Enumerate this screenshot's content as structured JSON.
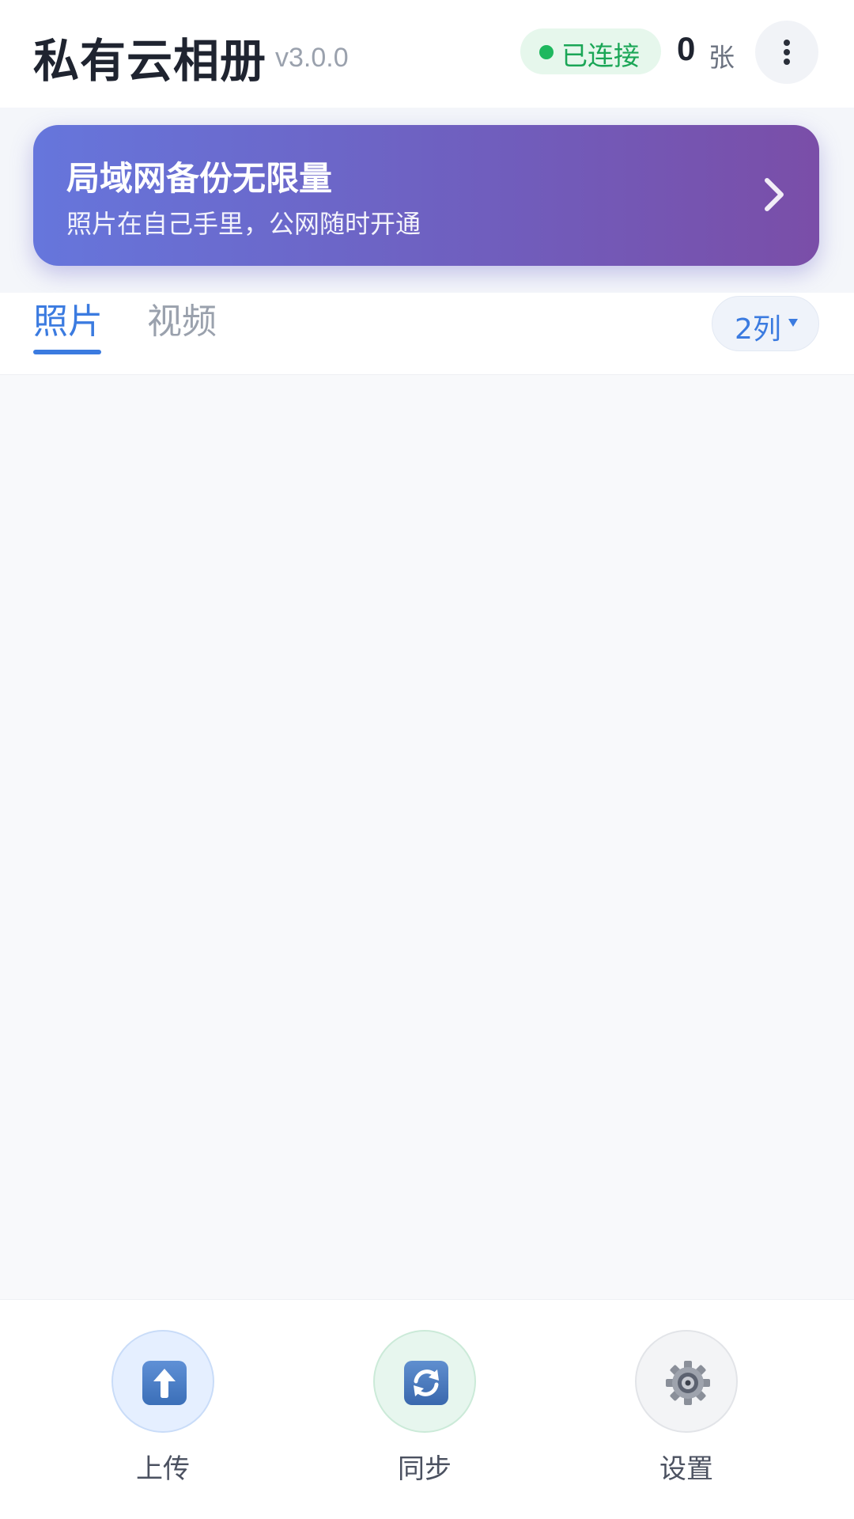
{
  "header": {
    "title": "私有云相册",
    "version": "v3.0.0",
    "status": "已连接",
    "photo_count": "0",
    "photo_count_unit": "张"
  },
  "banner": {
    "title": "局域网备份无限量",
    "subtitle": "照片在自己手里，公网随时开通"
  },
  "tabs": [
    {
      "label": "照片",
      "active": true
    },
    {
      "label": "视频",
      "active": false
    }
  ],
  "columns_selector": {
    "label": "2列"
  },
  "bottom_nav": [
    {
      "label": "上传",
      "icon": "upload-icon"
    },
    {
      "label": "同步",
      "icon": "sync-icon"
    },
    {
      "label": "设置",
      "icon": "settings-gear-icon"
    }
  ],
  "colors": {
    "accent": "#3b7be0",
    "status_green": "#1eb85e",
    "banner_start": "#6676dc",
    "banner_end": "#7a4ea8"
  }
}
